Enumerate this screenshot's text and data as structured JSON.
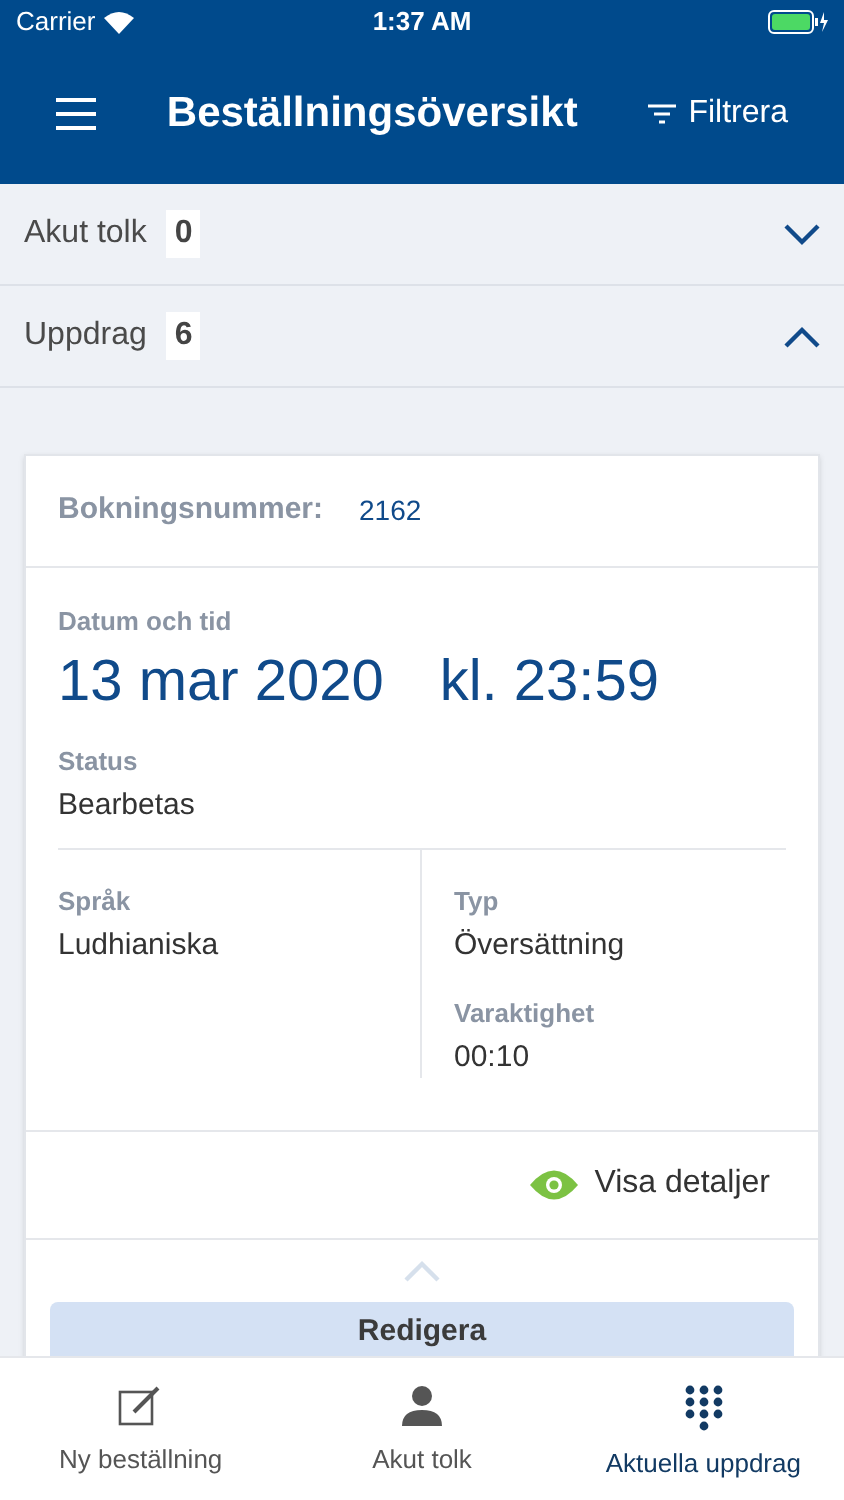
{
  "status_bar": {
    "carrier": "Carrier",
    "time": "1:37 AM"
  },
  "nav_bar": {
    "title": "Beställningsöversikt",
    "filter": "Filtrera"
  },
  "sections": [
    {
      "label": "Akut tolk",
      "count": "0",
      "expanded": false
    },
    {
      "label": "Uppdrag",
      "count": "6",
      "expanded": true
    }
  ],
  "card": {
    "booking_label": "Bokningsnummer:",
    "booking_number": "2162",
    "date_label": "Datum och tid",
    "date": "13 mar 2020",
    "time": "kl. 23:59",
    "status_label": "Status",
    "status": "Bearbetas",
    "left_fields": [
      {
        "label": "Språk",
        "value": "Ludhianiska"
      }
    ],
    "right_fields": [
      {
        "label": "Typ",
        "value": "Översättning"
      },
      {
        "label": "Varaktighet",
        "value": "00:10"
      }
    ],
    "details_link": "Visa detaljer",
    "edit_button": "Redigera"
  },
  "tab_bar": [
    {
      "label": "Ny beställning",
      "kind": "compose",
      "selected": false
    },
    {
      "label": "Akut tolk",
      "kind": "person",
      "selected": false
    },
    {
      "label": "Aktuella uppdrag",
      "kind": "dots",
      "selected": true
    }
  ]
}
